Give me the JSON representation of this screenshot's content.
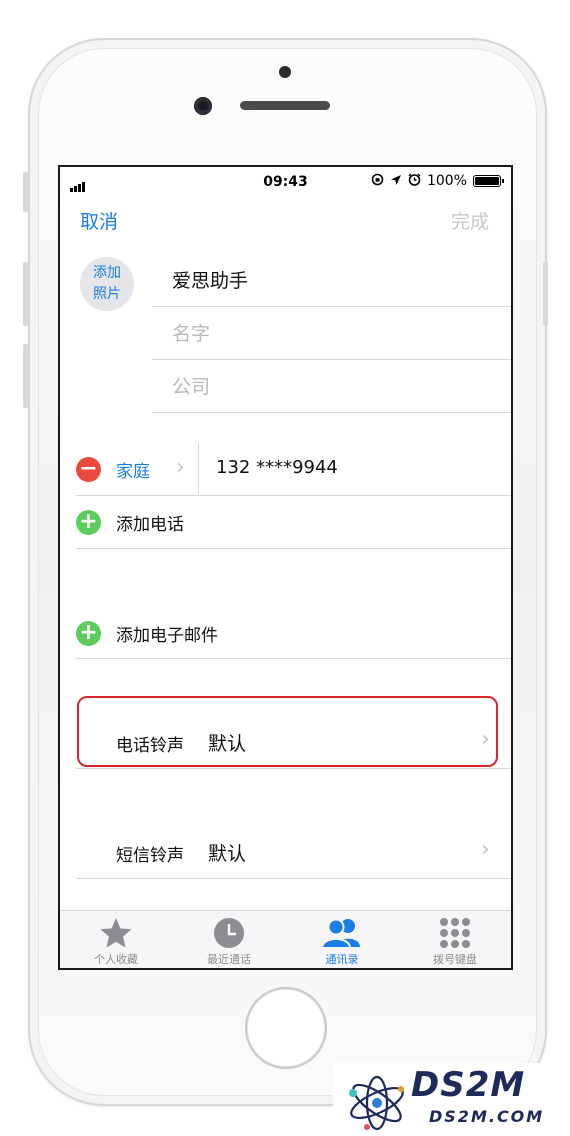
{
  "status_bar": {
    "time": "09:43",
    "battery": "100%",
    "battery_level": 1.0
  },
  "nav": {
    "cancel": "取消",
    "done": "完成"
  },
  "photo": {
    "line1": "添加",
    "line2": "照片"
  },
  "fields": {
    "company_name": "爱思助手",
    "name_placeholder": "名字",
    "company_placeholder": "公司"
  },
  "phone": {
    "label": "家庭",
    "number": "132 ****9944"
  },
  "add_phone": "添加电话",
  "add_email": "添加电子邮件",
  "ringtone": {
    "label": "电话铃声",
    "value": "默认"
  },
  "sms_tone": {
    "label": "短信铃声",
    "value": "默认"
  },
  "tabs": [
    {
      "label": "个人收藏",
      "icon": "star-icon"
    },
    {
      "label": "最近通话",
      "icon": "clock-icon"
    },
    {
      "label": "通讯录",
      "icon": "contacts-icon"
    },
    {
      "label": "拨号键盘",
      "icon": "keypad-icon"
    }
  ],
  "active_tab": 2,
  "watermark": {
    "title": "DS2M",
    "subtitle": "DS2M.COM"
  },
  "colors": {
    "accent": "#1a7ee8",
    "delete": "#e94a3b",
    "add": "#5ccd5c",
    "highlight": "#d9262b"
  }
}
